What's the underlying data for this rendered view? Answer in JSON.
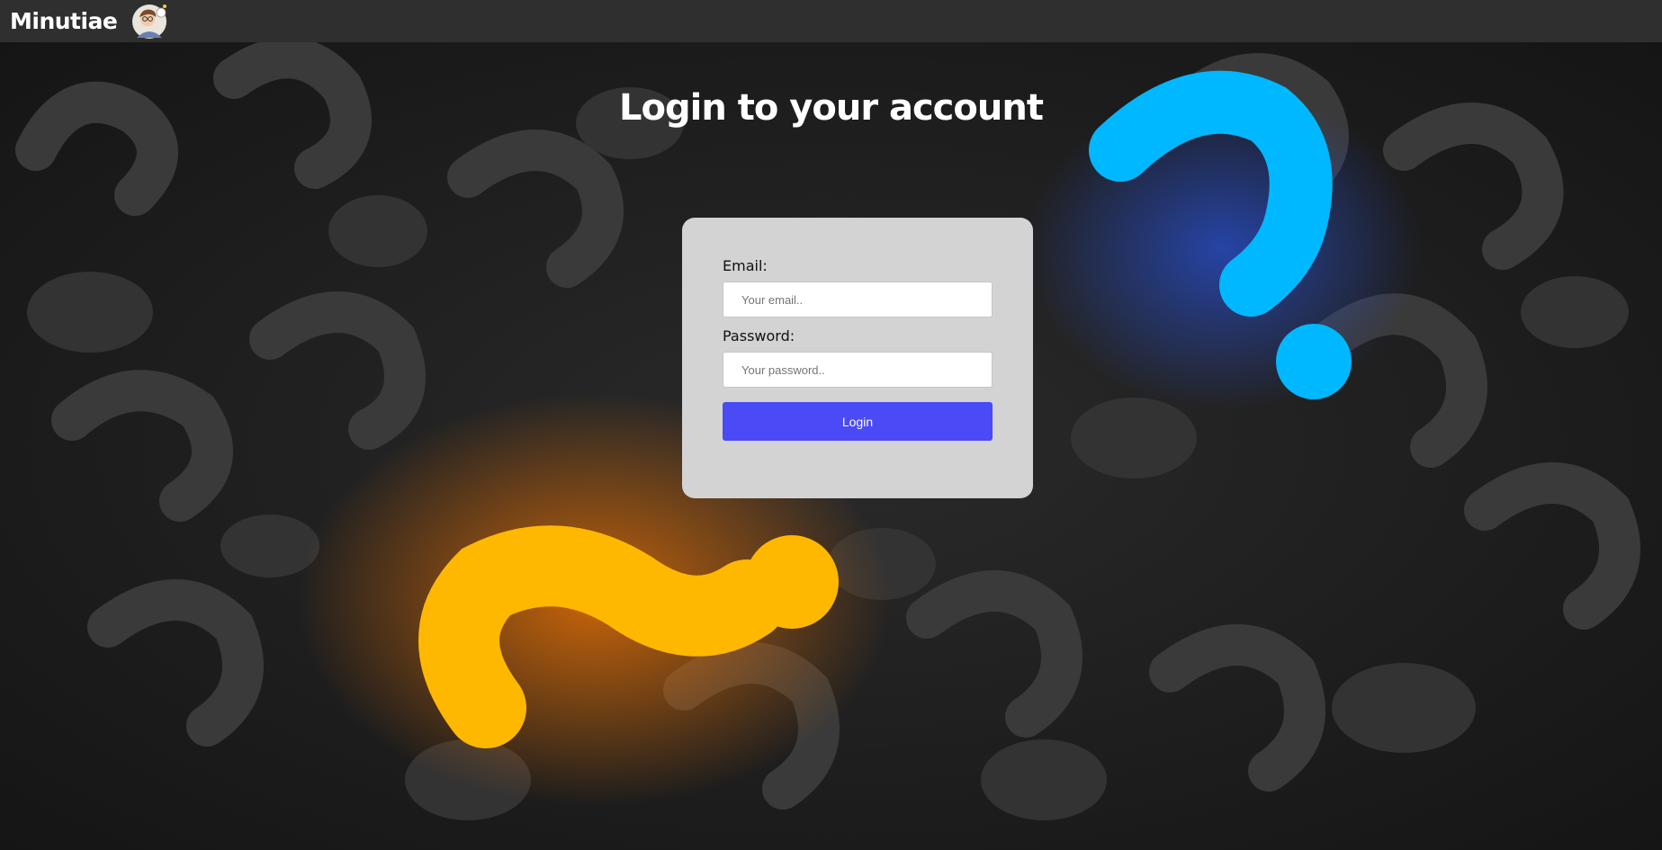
{
  "navbar": {
    "brand": "Minutiae",
    "avatar_icon": "user-avatar-icon"
  },
  "page": {
    "title": "Login to your account"
  },
  "form": {
    "email_label": "Email:",
    "email_placeholder": "Your email..",
    "email_value": "",
    "password_label": "Password:",
    "password_placeholder": "Your password..",
    "password_value": "",
    "submit_label": "Login"
  },
  "colors": {
    "navbar": "#2f2f2f",
    "card": "#d3d3d3",
    "button": "#4a4af7",
    "accent_orange": "#ffb800",
    "accent_blue": "#00b8ff"
  }
}
